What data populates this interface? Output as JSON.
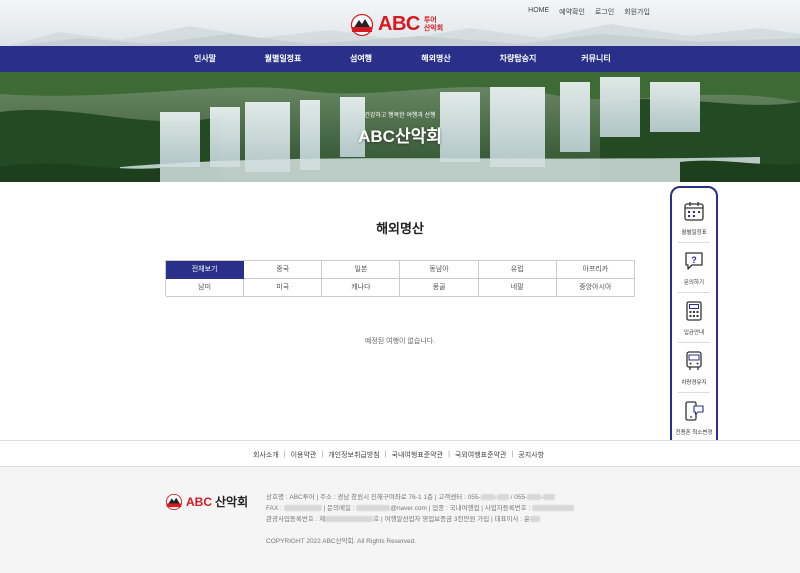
{
  "header": {
    "top_links": [
      "HOME",
      "예약확인",
      "로그인",
      "회원가입"
    ],
    "logo_main": "ABC",
    "logo_sub_1": "투어",
    "logo_sub_2": "산악회"
  },
  "mainnav": {
    "items": [
      "인사말",
      "월별일정표",
      "섬여행",
      "해외명산",
      "차량탑승지",
      "커뮤니티"
    ]
  },
  "hero": {
    "subtitle": "건강하고 행복한 여행과 산행",
    "title": "ABC산악회"
  },
  "content": {
    "page_title": "해외명산",
    "categories_row1": [
      "전체보기",
      "중국",
      "일본",
      "동남아",
      "유럽",
      "아프리카"
    ],
    "categories_row2": [
      "남미",
      "미국",
      "캐나다",
      "몽골",
      "네팔",
      "중앙아시아"
    ],
    "active_category": "전체보기",
    "empty_message": "예정된 여행이 없습니다."
  },
  "quick_menu": {
    "items": [
      {
        "label": "월별일정표",
        "icon": "calendar-icon"
      },
      {
        "label": "문의하기",
        "icon": "question-chat-icon"
      },
      {
        "label": "입금안내",
        "icon": "calculator-icon"
      },
      {
        "label": "차량경유지",
        "icon": "bus-icon"
      },
      {
        "label": "전용폰 최소변경",
        "icon": "phone-chat-icon"
      },
      {
        "label": "",
        "icon": "mountain-hiker-icon"
      }
    ]
  },
  "footer": {
    "links": [
      "회사소개",
      "이용약관",
      "개인정보취급방침",
      "국내여행표준약관",
      "국외여행표준약관",
      "공지사항"
    ],
    "logo_main": "ABC",
    "logo_text": "산악회",
    "line1_a": "상호명 : ABC투어 | 주소 : 경남 창원시 진해구여좌로 76-1 1층 | 고객센터 : 055-",
    "line1_b": " / 055-",
    "line2_a": "FAX : ",
    "line2_b": " | 문의메일 : ",
    "line2_c": "@naver.com | 업종 : 국내여행업 | 사업자등록번호 : ",
    "line3_a": "관광사업등록번호 : 제",
    "line3_b": "호 | 여행알선업자 영업보증금 3천만원 가입 | 대표이사 : 윤",
    "copyright": "COPYRIGHT 2022 ABC산악회. All Rights Reserved.",
    "brand_red": "#d71920",
    "nav_blue": "#2a2f89"
  }
}
